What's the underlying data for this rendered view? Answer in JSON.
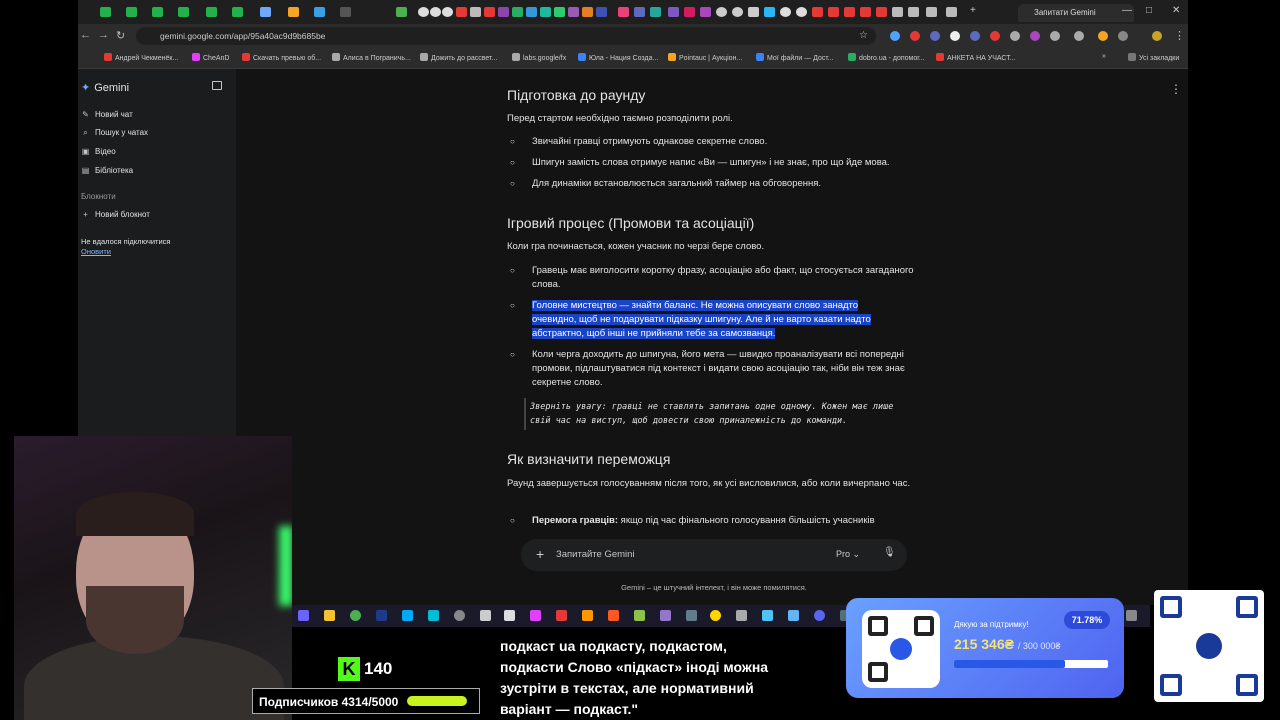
{
  "browser": {
    "url": "gemini.google.com/app/95a40ac9d9b685be",
    "active_tab_title": "Запитати Gemini",
    "bookmarks": [
      "Андрей Чекменёк...",
      "CheAnD",
      "Скачать превью об...",
      "Алиса в Пограничь...",
      "Дожить до рассвет...",
      "labs.google/fx",
      "Юла - Нация Созда...",
      "Pointauc | Аукціон...",
      "Мої файли — Дост...",
      "dobro.ua - допомог...",
      "АНКЕТА НА УЧАСТ..."
    ],
    "all_bookmarks": "Усі закладки"
  },
  "sidebar": {
    "brand": "Gemini",
    "items": [
      {
        "label": "Новий чат",
        "icon": "edit-icon"
      },
      {
        "label": "Пошук у чатах",
        "icon": "search-icon"
      },
      {
        "label": "Відео",
        "icon": "video-icon"
      },
      {
        "label": "Бібліотека",
        "icon": "library-icon"
      }
    ],
    "notebooks_heading": "Блокноти",
    "new_notebook": "Новий блокнот",
    "connection_error": "Не вдалося підключитися",
    "refresh": "Оновити"
  },
  "article": {
    "h1": "Підготовка до раунду",
    "p1": "Перед стартом необхідно таємно розподілити ролі.",
    "list1": [
      "Звичайні гравці отримують однакове секретне слово.",
      "Шпигун замість слова отримує напис «Ви — шпигун» і не знає, про що йде мова.",
      "Для динаміки встановлюється загальний таймер на обговорення."
    ],
    "h2": "Ігровий процес (Промови та асоціації)",
    "p2": "Коли гра починається, кожен учасник по черзі бере слово.",
    "list2_a": "Гравець має виголосити коротку фразу, асоціацію або факт, що стосується загаданого слова.",
    "list2_b_selected": "Головне мистецтво — знайти баланс. Не можна описувати слово занадто очевидно, щоб не подарувати підказку шпигуну. Але й не варто казати надто абстрактно, щоб інші не прийняли тебе за самозванця.",
    "list2_c": "Коли черга доходить до шпигуна, його мета — швидко проаналізувати всі попередні промови, підлаштуватися під контекст і видати свою асоціацію так, ніби він теж знає секретне слово.",
    "quote": "Зверніть увагу: гравці не ставлять запитань одне одному. Кожен має лише свій час на виступ, щоб довести свою приналежність до команди.",
    "h3": "Як визначити переможця",
    "p3": "Раунд завершується голосуванням після того, як усі висловилися, або коли вичерпано час.",
    "list3_bold": "Перемога гравців:",
    "list3_rest": " якщо під час фінального голосування більшість учасників"
  },
  "input": {
    "placeholder": "Запитайте Gemini",
    "model": "Pro",
    "disclaimer": "Gemini – це штучний інтелект, і він може помилятися."
  },
  "overlay": {
    "kick_followers": "140",
    "subscribers": "Подписчиков 4314/5000",
    "subtitle": "подкаст uа подкасту, подкастом, подкасти Слово «підкаст» іноді можна зустріти в текстах, але нормативний варіант — подкаст.\"",
    "donate_thanks": "Дякую за підтримку!",
    "donate_percent": "71.78%",
    "donate_amount": "215 346₴",
    "donate_goal": "/ 300 000₴",
    "donate_progress": 0.7178
  },
  "colors": {
    "selection": "#1a44c8",
    "kick_green": "#53fc18",
    "donate_blue": "#4f63f0"
  }
}
